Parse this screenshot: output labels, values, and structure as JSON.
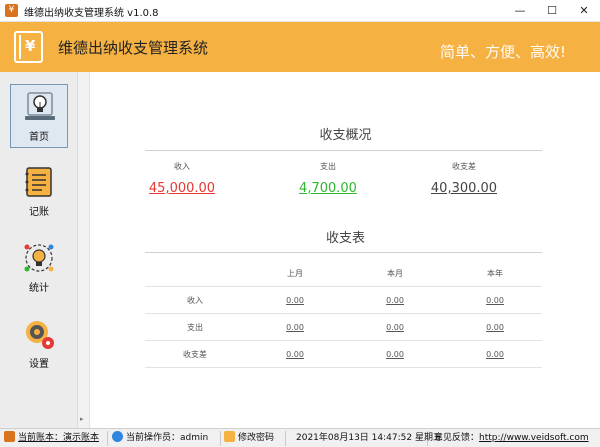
{
  "window": {
    "title": "维德出纳收支管理系统    v1.0.8",
    "minimize_glyph": "—",
    "maximize_glyph": "☐",
    "close_glyph": "✕"
  },
  "header": {
    "system_name": "维德出纳收支管理系统",
    "slogan": "简单、方便、高效!",
    "logo_glyph": "¥"
  },
  "sidebar": {
    "items": [
      {
        "label": "首页",
        "icon": "lightbulb-icon",
        "active": true
      },
      {
        "label": "记账",
        "icon": "notebook-icon",
        "active": false
      },
      {
        "label": "统计",
        "icon": "bulb-cycle-icon",
        "active": false
      },
      {
        "label": "设置",
        "icon": "gear-icon",
        "active": false
      }
    ]
  },
  "overview": {
    "title": "收支概况",
    "stats": [
      {
        "caption": "收入",
        "value": "45,000.00",
        "color": "#e53935"
      },
      {
        "caption": "支出",
        "value": "4,700.00",
        "color": "#2eb82e"
      },
      {
        "caption": "收支差",
        "value": "40,300.00",
        "color": "#444444"
      }
    ]
  },
  "table": {
    "title": "收支表",
    "columns": [
      "",
      "上月",
      "本月",
      "本年"
    ],
    "rows": [
      {
        "label": "收入",
        "values": [
          "0.00",
          "0.00",
          "0.00"
        ]
      },
      {
        "label": "支出",
        "values": [
          "0.00",
          "0.00",
          "0.00"
        ]
      },
      {
        "label": "收支差",
        "values": [
          "0.00",
          "0.00",
          "0.00"
        ]
      }
    ]
  },
  "statusbar": {
    "account": "当前账本：演示账本",
    "operator": "当前操作员：admin",
    "change_password": "修改密码",
    "datetime": "2021年08月13日 14:47:52 星期五",
    "feedback": "意见反馈：",
    "url": "http://www.veidsoft.com"
  }
}
